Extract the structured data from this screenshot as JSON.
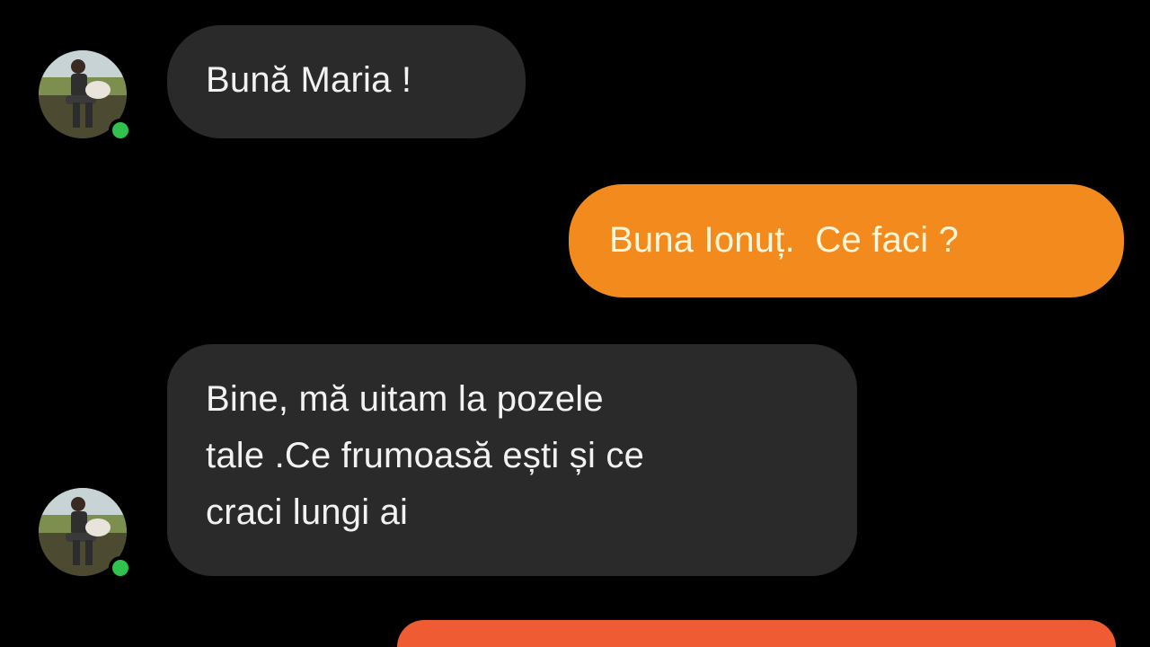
{
  "messages": [
    {
      "direction": "incoming",
      "text": "Bună Maria !"
    },
    {
      "direction": "outgoing",
      "text": "Buna Ionuț.  Ce faci ?"
    },
    {
      "direction": "incoming",
      "lines": [
        "Bine, mă uitam la pozele",
        "tale .Ce frumoasă ești și ce",
        "craci lungi ai"
      ]
    }
  ],
  "colors": {
    "background": "#000000",
    "incoming_bubble": "#2a2a2a",
    "outgoing_bubble": "#f28a1e",
    "outgoing_bubble_partial": "#ef5b33",
    "online_dot": "#31c24d"
  },
  "icons": {
    "online_status": "online-status-dot",
    "avatar": "contact-avatar"
  }
}
